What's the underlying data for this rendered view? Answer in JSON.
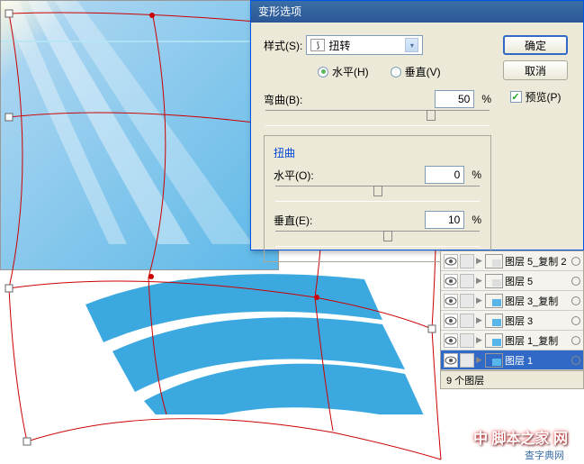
{
  "dialog": {
    "title": "变形选项",
    "style_label": "样式(S):",
    "style_value": "扭转",
    "radio_h": "水平(H)",
    "radio_v": "垂直(V)",
    "bend_label": "弯曲(B):",
    "bend_value": "50",
    "pct": "%",
    "distort_title": "扭曲",
    "hdist_label": "水平(O):",
    "hdist_value": "0",
    "vdist_label": "垂直(E):",
    "vdist_value": "10",
    "ok_label": "确定",
    "cancel_label": "取消",
    "preview_label": "预览(P)"
  },
  "layers": {
    "items": [
      {
        "name": "图层 5_复制 2",
        "color": "#dedede"
      },
      {
        "name": "图层 5",
        "color": "#dedede"
      },
      {
        "name": "图层 3_复制",
        "color": "#56b6ea"
      },
      {
        "name": "图层 3",
        "color": "#56b6ea"
      },
      {
        "name": "图层 1_复制",
        "color": "#56b6ea"
      },
      {
        "name": "图层 1",
        "color": "#56b6ea"
      }
    ],
    "footer": "9 个图层"
  },
  "watermark": "中 脚本之家 网",
  "watermark2": "查字典网"
}
